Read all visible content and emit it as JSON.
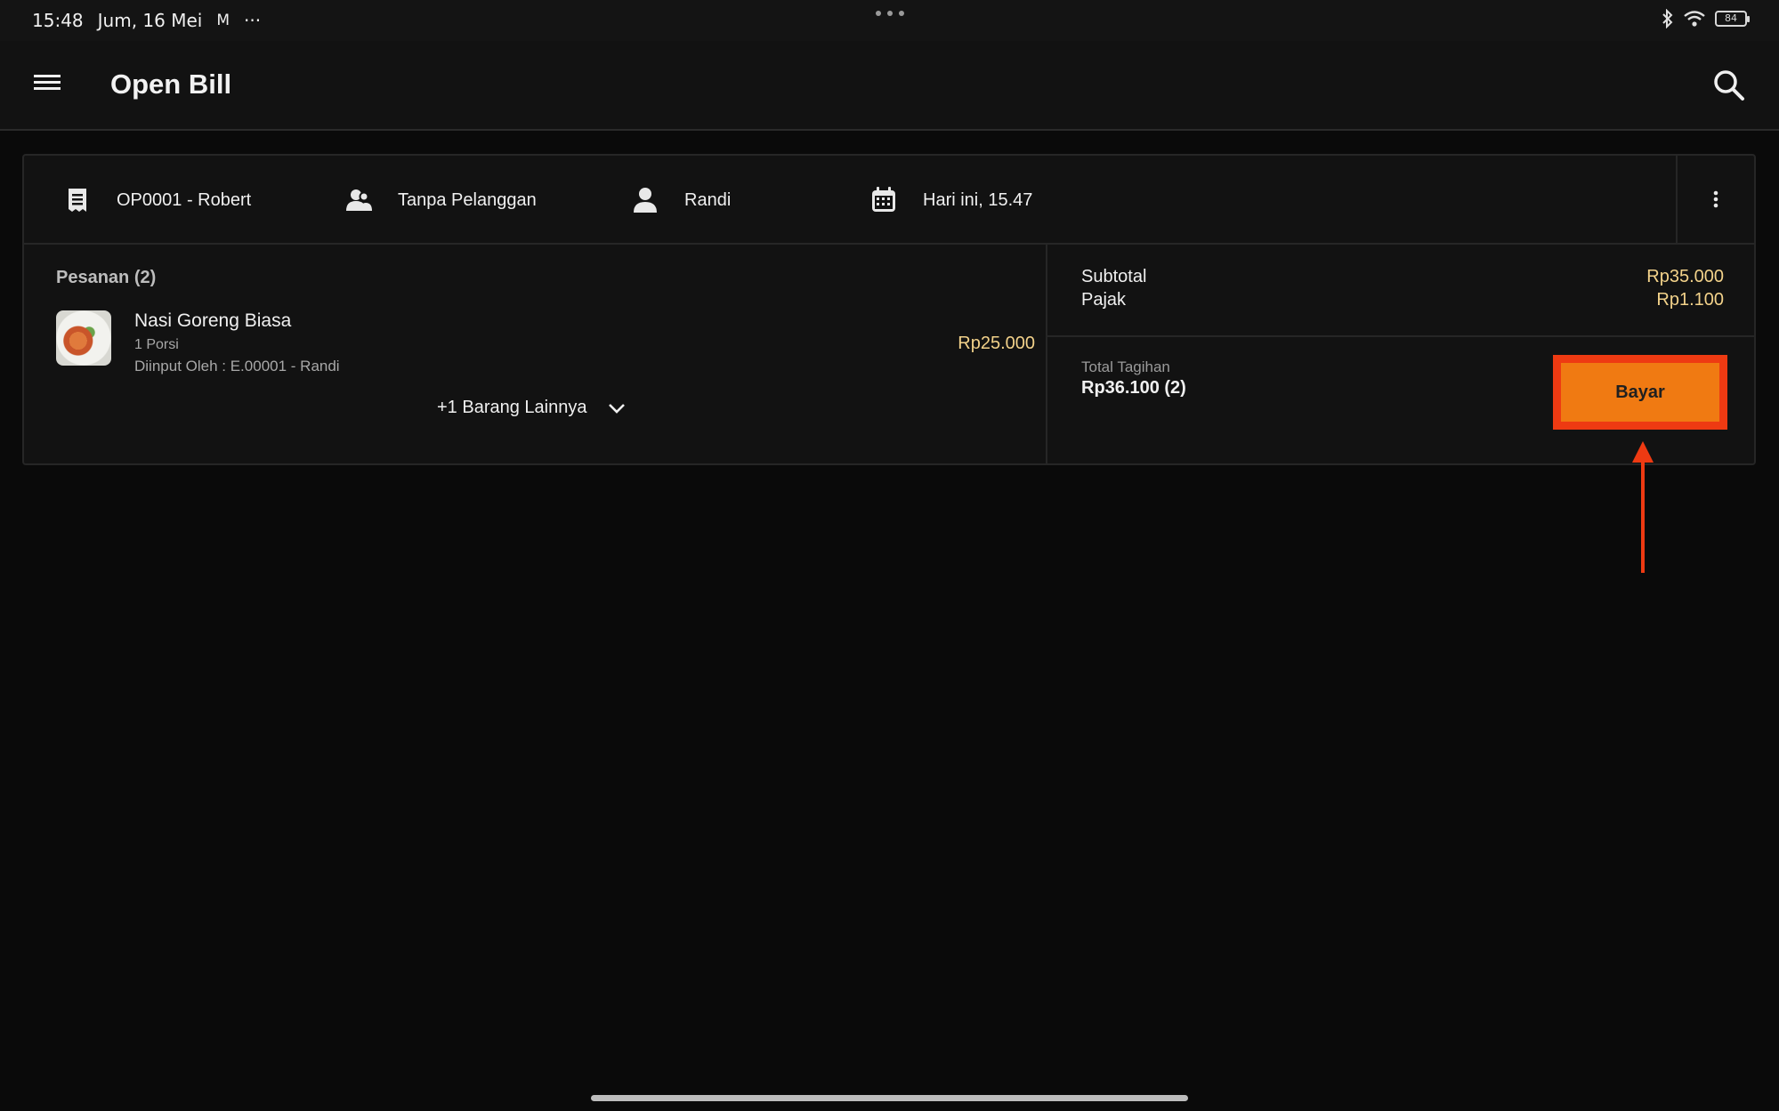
{
  "status_bar": {
    "time": "15:48",
    "date": "Jum, 16 Mei",
    "mail_icon": "M",
    "more": "···",
    "battery_level": "84",
    "icons": [
      "bluetooth-icon",
      "wifi-icon",
      "battery-icon"
    ]
  },
  "app_bar": {
    "title": "Open Bill",
    "menu_icon": "hamburger-menu-icon",
    "search_icon": "search-icon"
  },
  "bill": {
    "header": {
      "bill_id": "OP0001 - Robert",
      "customer": "Tanpa Pelanggan",
      "staff": "Randi",
      "time": "Hari ini, 15.47"
    },
    "orders": {
      "title": "Pesanan (2)",
      "items": [
        {
          "name": "Nasi Goreng Biasa",
          "qty": "1 Porsi",
          "entered_by": "Diinput Oleh  : E.00001 - Randi",
          "price": "Rp25.000"
        }
      ],
      "more_label": "+1 Barang Lainnya"
    },
    "summary": {
      "subtotal_label": "Subtotal",
      "subtotal_value": "Rp35.000",
      "tax_label": "Pajak",
      "tax_value": "Rp1.100",
      "total_label": "Total Tagihan",
      "total_value": "Rp36.100 (2)",
      "pay_label": "Bayar"
    }
  },
  "colors": {
    "accent": "#f07a12",
    "highlight": "#ee3a12",
    "price": "#f3d28a",
    "background": "#0a0a0a",
    "surface": "#121212"
  }
}
